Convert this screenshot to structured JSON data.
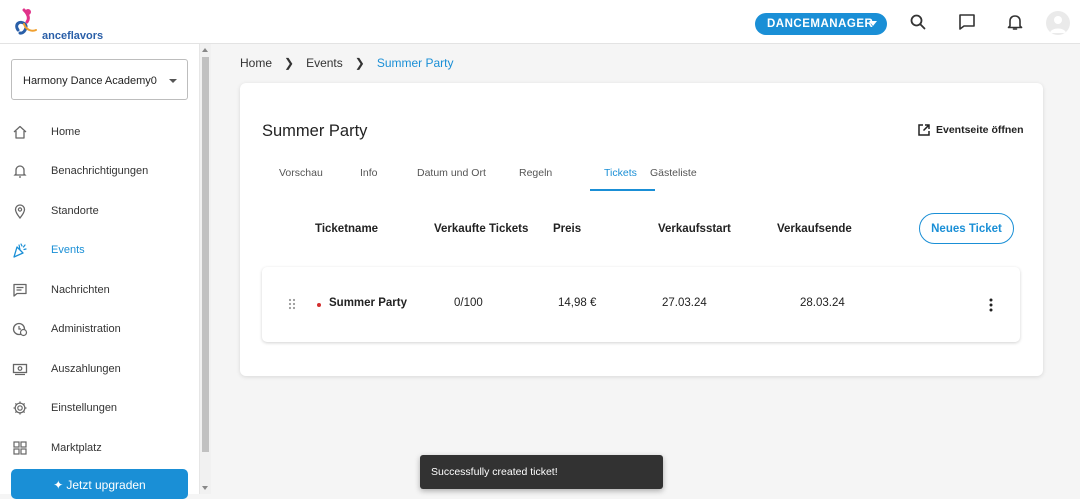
{
  "brand": {
    "logo_text": "anceflavors",
    "accent": "#1a8fd6"
  },
  "topbar": {
    "account_button": "DANCEMANAGER",
    "icons": [
      "search-icon",
      "chat-icon",
      "bell-icon",
      "avatar"
    ]
  },
  "sidebar": {
    "school_select": "Harmony Dance Academy0",
    "items": [
      {
        "label": "Home",
        "icon": "home-icon"
      },
      {
        "label": "Benachrichtigungen",
        "icon": "bell-icon"
      },
      {
        "label": "Standorte",
        "icon": "location-icon"
      },
      {
        "label": "Events",
        "icon": "party-popper-icon",
        "active": true
      },
      {
        "label": "Nachrichten",
        "icon": "message-icon"
      },
      {
        "label": "Administration",
        "icon": "admin-icon"
      },
      {
        "label": "Auszahlungen",
        "icon": "payout-icon"
      },
      {
        "label": "Einstellungen",
        "icon": "gear-icon"
      },
      {
        "label": "Marktplatz",
        "icon": "grid-icon"
      }
    ],
    "upgrade_label": "Jetzt upgraden"
  },
  "breadcrumb": {
    "items": [
      "Home",
      "Events",
      "Summer Party"
    ]
  },
  "event": {
    "title": "Summer Party",
    "open_link": "Eventseite öffnen",
    "tabs": [
      "Vorschau",
      "Info",
      "Datum und Ort",
      "Regeln",
      "Tickets",
      "Gästeliste"
    ],
    "active_tab": "Tickets"
  },
  "tickets": {
    "columns": [
      "Ticketname",
      "Verkaufte Tickets",
      "Preis",
      "Verkaufsstart",
      "Verkaufsende"
    ],
    "new_button": "Neues Ticket",
    "rows": [
      {
        "name": "Summer Party",
        "sold": "0/100",
        "price": "14,98 €",
        "start": "27.03.24",
        "end": "28.03.24"
      }
    ]
  },
  "toast": {
    "message": "Successfully created ticket!"
  }
}
